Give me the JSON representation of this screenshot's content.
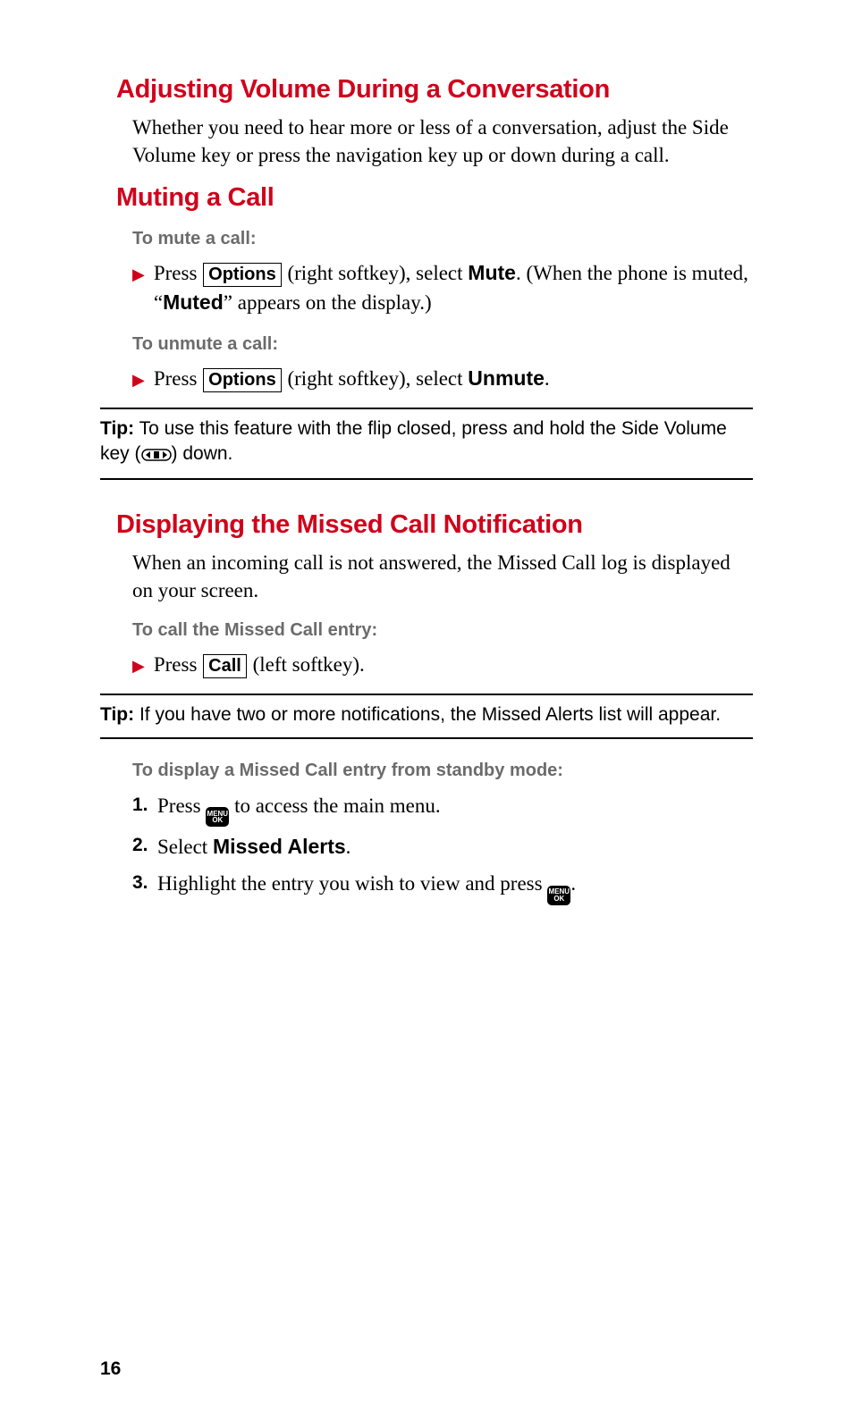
{
  "section1": {
    "heading": "Adjusting Volume During a Conversation",
    "body": "Whether you need to hear more or less of a conversation, adjust the Side Volume key or press the navigation key up or down during a call."
  },
  "section2": {
    "heading": "Muting a Call",
    "sub1": "To mute a call:",
    "step1_a": "Press ",
    "step1_key": "Options",
    "step1_b": " (right softkey), select ",
    "step1_bold": "Mute",
    "step1_c": ". (When the phone is muted, “",
    "step1_bold2": "Muted",
    "step1_d": "” appears on the display.)",
    "sub2": "To unmute a call:",
    "step2_a": "Press ",
    "step2_key": "Options",
    "step2_b": " (right softkey), select ",
    "step2_bold": "Unmute",
    "step2_c": "."
  },
  "tip1": {
    "label": "Tip:",
    "text_a": " To use this feature with the flip closed, press and hold the Side Volume key (",
    "text_b": ") down."
  },
  "section3": {
    "heading": "Displaying the Missed Call Notification",
    "body": "When an incoming call is not answered, the Missed Call log is displayed on your screen.",
    "sub1": "To call the Missed Call entry:",
    "step1_a": "Press ",
    "step1_key": "Call",
    "step1_b": " (left softkey)."
  },
  "tip2": {
    "label": "Tip:",
    "text": " If you have two or more notifications, the Missed Alerts list will appear."
  },
  "section4": {
    "sub": "To display a Missed Call entry from standby mode:",
    "num1": "1.",
    "li1_a": "Press ",
    "li1_b": " to access the main menu.",
    "num2": "2.",
    "li2_a": "Select ",
    "li2_bold": "Missed Alerts",
    "li2_b": ".",
    "num3": "3.",
    "li3_a": "Highlight the entry you wish to view and press ",
    "li3_b": "."
  },
  "menu_key": {
    "line1": "MENU",
    "line2": "OK"
  },
  "page_number": "16"
}
